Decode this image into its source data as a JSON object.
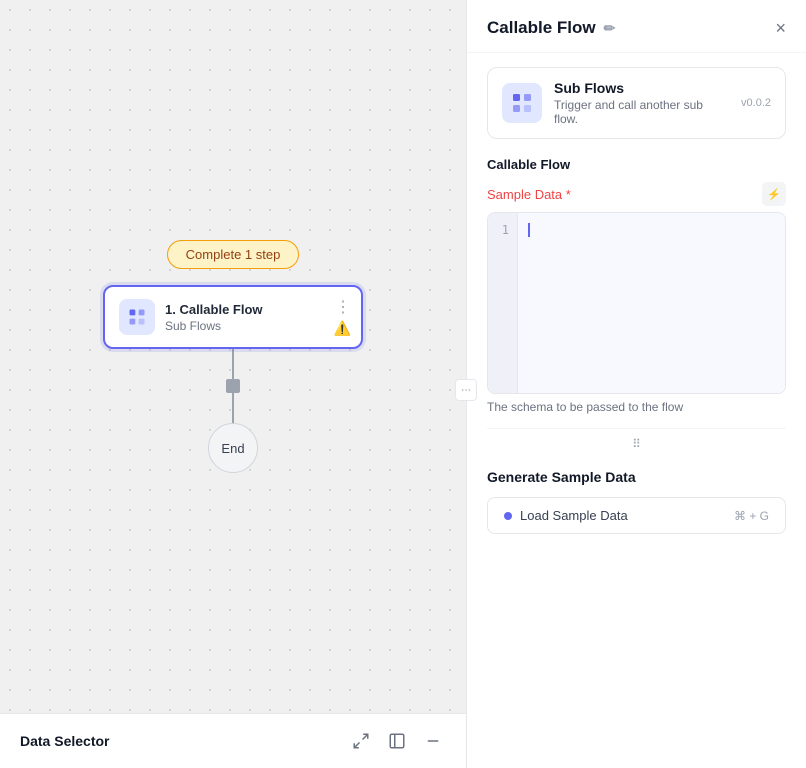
{
  "canvas": {
    "complete_step_label": "Complete 1 step",
    "node": {
      "title": "1. Callable Flow",
      "subtitle": "Sub Flows"
    },
    "end_label": "End"
  },
  "bottom_bar": {
    "title": "Data Selector",
    "expand_label": "expand",
    "sidebar_label": "sidebar",
    "minus_label": "minimize"
  },
  "panel": {
    "title": "Callable Flow",
    "close_label": "×",
    "edit_label": "✏",
    "plugin": {
      "name": "Sub Flows",
      "description": "Trigger and call another sub flow.",
      "version": "v0.0.2"
    },
    "section_label": "Callable Flow",
    "field": {
      "label": "Sample Data *",
      "hint": "The schema to be passed to the flow",
      "icon_label": "⚡"
    },
    "generate": {
      "title": "Generate Sample Data",
      "load_button": "Load Sample Data",
      "shortcut": "⌘ + G"
    }
  }
}
